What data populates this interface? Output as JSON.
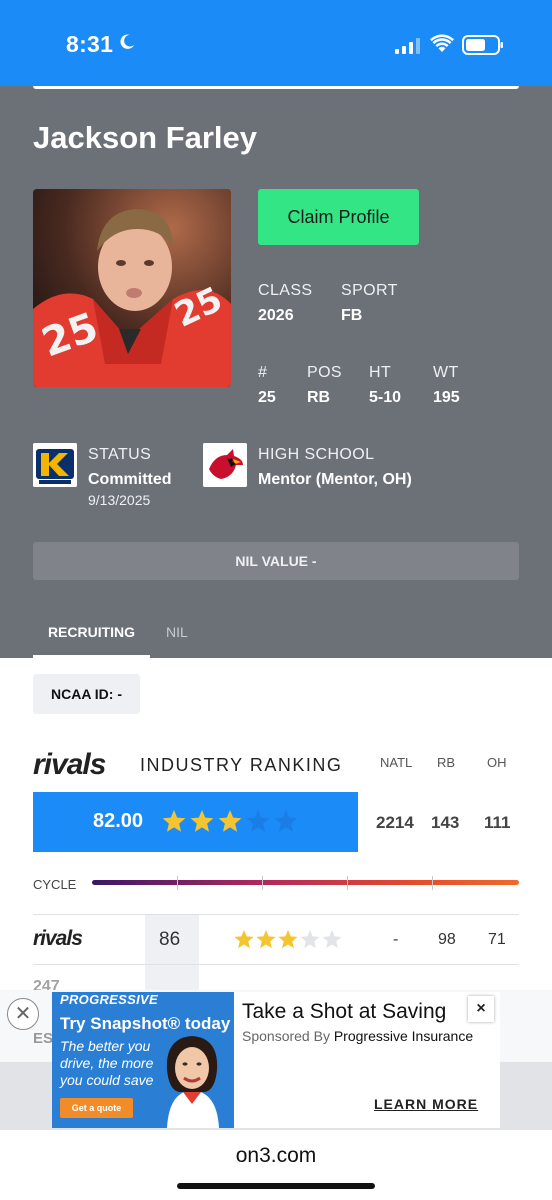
{
  "status_bar": {
    "time": "8:31"
  },
  "profile": {
    "name": "Jackson Farley",
    "claim_label": "Claim Profile",
    "class_label": "CLASS",
    "class_value": "2026",
    "sport_label": "SPORT",
    "sport_value": "FB",
    "number_label": "#",
    "number_value": "25",
    "pos_label": "POS",
    "pos_value": "RB",
    "ht_label": "HT",
    "ht_value": "5-10",
    "wt_label": "WT",
    "wt_value": "195",
    "status_label": "STATUS",
    "status_value": "Committed",
    "status_date": "9/13/2025",
    "hs_label": "HIGH SCHOOL",
    "hs_value": "Mentor (Mentor, OH)",
    "nil_value_label": "NIL VALUE -",
    "jersey_print": "25"
  },
  "tabs": [
    "RECRUITING",
    "NIL"
  ],
  "recruiting": {
    "ncaa_id": "NCAA ID:  -",
    "rivals_logo": "rivals",
    "industry_title": "INDUSTRY RANKING",
    "columns": [
      "NATL",
      "RB",
      "OH"
    ],
    "industry_score": "82.00",
    "industry_stars": 3,
    "industry_ranks": [
      "2214",
      "143",
      "111"
    ],
    "cycle_label": "CYCLE",
    "rows": [
      {
        "service": "rivals",
        "score": "86",
        "stars": 3,
        "natl": "-",
        "pos": "98",
        "state": "71"
      }
    ],
    "partial_row": "247",
    "partial_row2": "ES"
  },
  "ad": {
    "brand": "PROGRESSIVE",
    "try_text": "Try Snapshot® today",
    "sub_text": "The better you drive, the more you could save",
    "cta": "Get a quote",
    "headline": "Take a Shot at Saving",
    "sponsor_prefix": "Sponsored By",
    "sponsor": "Progressive Insurance",
    "close": "×",
    "learn_more": "LEARN MORE"
  },
  "browser": {
    "url": "on3.com"
  },
  "colors": {
    "accent": "#1b8cf7",
    "claim": "#33e585",
    "star": "#f5c431"
  }
}
